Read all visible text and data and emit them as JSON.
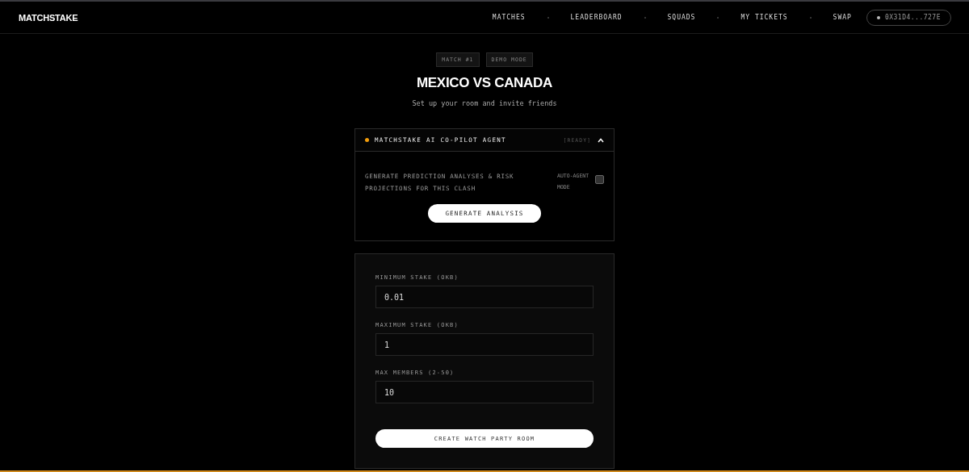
{
  "header": {
    "logo": "MATCHSTAKE",
    "nav": [
      {
        "label": "MATCHES"
      },
      {
        "label": "LEADERBOARD"
      },
      {
        "label": "SQUADS"
      },
      {
        "label": "MY TICKETS"
      },
      {
        "label": "SWAP"
      }
    ],
    "wallet": "0X31D4...727E"
  },
  "badges": [
    "MATCH #1",
    "DEMO MODE"
  ],
  "title": "MEXICO VS CANADA",
  "subtitle": "Set up your room and invite friends",
  "agent": {
    "title": "MATCHSTAKE AI CO-PILOT AGENT",
    "status": "[READY]",
    "color": "#f59e0b",
    "expanded": true,
    "description": "GENERATE PREDICTION ANALYSES & RISK PROJECTIONS FOR THIS CLASH",
    "auto_label": "AUTO-AGENT MODE",
    "auto_checked": false,
    "button": "GENERATE ANALYSIS"
  },
  "form": {
    "fields": [
      {
        "label": "MINIMUM STAKE (OKB)",
        "value": "0.01"
      },
      {
        "label": "MAXIMUM STAKE (OKB)",
        "value": "1"
      },
      {
        "label": "MAX MEMBERS (2-50)",
        "value": "10"
      }
    ],
    "submit": "CREATE WATCH PARTY ROOM"
  }
}
